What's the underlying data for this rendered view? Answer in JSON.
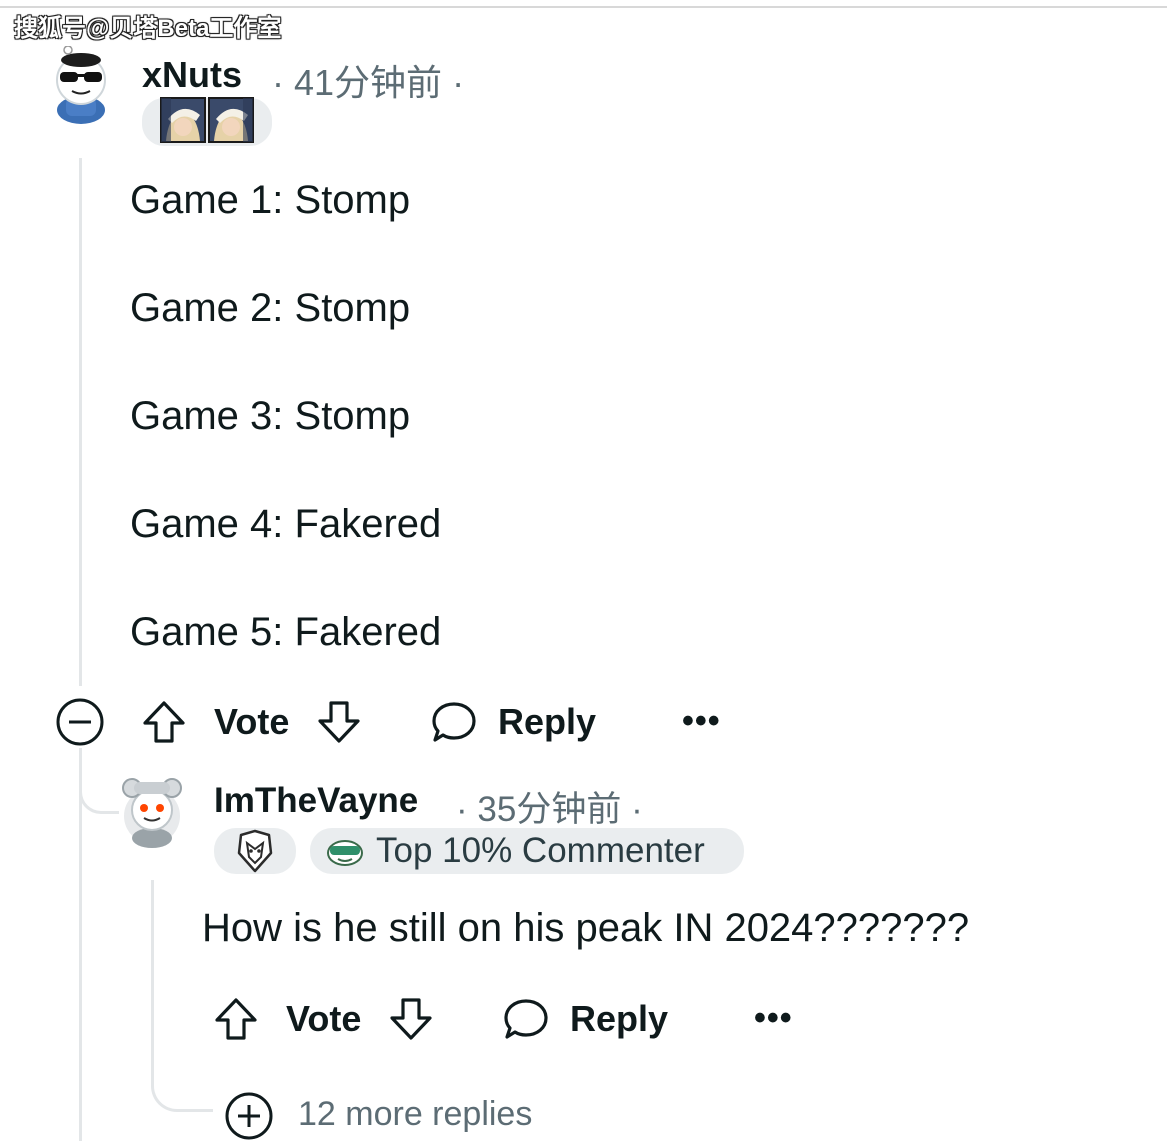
{
  "watermark": "搜狐号@贝塔Beta工作室",
  "comment1": {
    "username": "xNuts",
    "time": "41分钟前",
    "flair_icons": [
      "champion-portrait-icon",
      "champion-portrait-icon"
    ],
    "lines": [
      "Game 1: Stomp",
      "Game 2: Stomp",
      "Game 3: Stomp",
      "Game 4: Fakered",
      "Game 5: Fakered"
    ],
    "actions": {
      "vote": "Vote",
      "reply": "Reply",
      "more": "•••"
    }
  },
  "comment2": {
    "username": "ImTheVayne",
    "time": "35分钟前",
    "flair_icon": "g2-esports-logo-icon",
    "badge": "Top 10% Commenter",
    "text": "How is he still on his peak IN 2024???????",
    "actions": {
      "vote": "Vote",
      "reply": "Reply",
      "more": "•••"
    }
  },
  "more_replies": "12 more replies",
  "colors": {
    "text": "#0f1a1c",
    "meta": "#5c6c74",
    "pill": "#eaedef",
    "thread": "#e3e6e8"
  }
}
